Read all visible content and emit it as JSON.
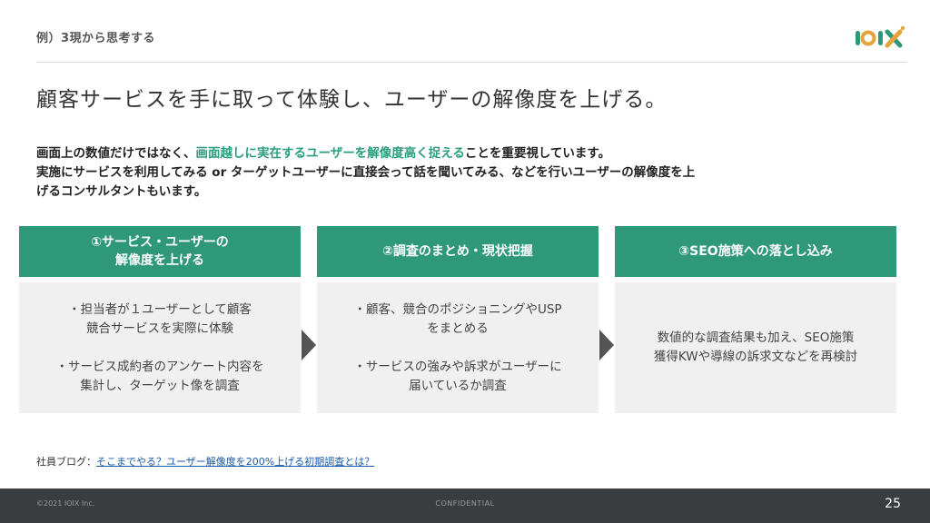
{
  "section_label": "例）3現から思考する",
  "logo_text": "IOIX",
  "headline": "顧客サービスを手に取って体験し、ユーザーの解像度を上げる。",
  "lead": {
    "part1": "画面上の数値だけではなく、",
    "highlight": "画面越しに実在するユーザーを解像度高く捉える",
    "part2": "ことを重要視しています。",
    "line2": "実施にサービスを利用してみる or ターゲットユーザーに直接会って話を聞いてみる、などを行いユーザーの解像度を上",
    "line3": "げるコンサルタントもいます。"
  },
  "columns": [
    {
      "title_line1": "①サービス・ユーザーの",
      "title_line2": "解像度を上げる",
      "body_p1": "・担当者が１ユーザーとして顧客\n競合サービスを実際に体験",
      "body_p2": "・サービス成約者のアンケート内容を\n集計し、ターゲット像を調査"
    },
    {
      "title_line1": "②調査のまとめ・現状把握",
      "body_p1": "・顧客、競合のポジショニングやUSP\nをまとめる",
      "body_p2": "・サービスの強みや訴求がユーザーに\n届いているか調査"
    },
    {
      "title_line1": "③SEO施策への落とし込み",
      "body_p1": "数値的な調査結果も加え、SEO施策\n獲得KWや導線の訴求文などを再検討"
    }
  ],
  "blog": {
    "label": "社員ブログ：",
    "link_text": "そこまでやる？ユーザー解像度を200%上げる初期調査とは？"
  },
  "footer": {
    "copyright": "©2021 IOIX Inc.",
    "confidential": "CONFIDENTIAL",
    "page_number": "25"
  },
  "colors": {
    "accent": "#2f9879",
    "highlight_text": "#2a9d7e",
    "footer_bg": "#3a3d40"
  }
}
